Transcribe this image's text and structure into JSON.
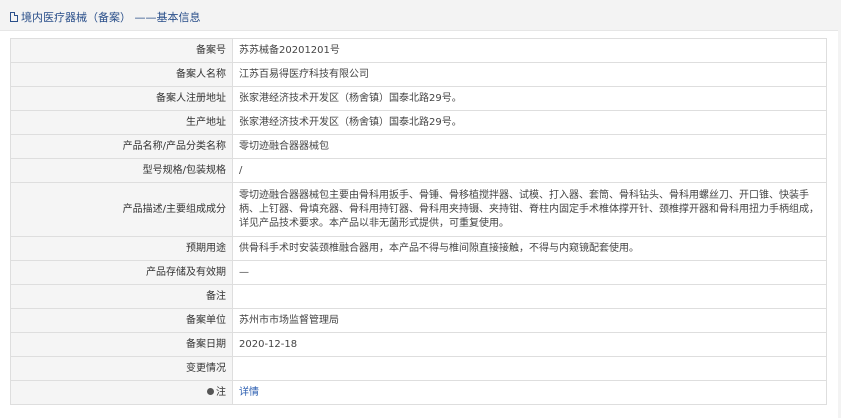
{
  "title": "境内医疗器械（备案） ——基本信息",
  "rows": [
    {
      "label": "备案号",
      "value": "苏苏械备20201201号"
    },
    {
      "label": "备案人名称",
      "value": "江苏百易得医疗科技有限公司"
    },
    {
      "label": "备案人注册地址",
      "value": "张家港经济技术开发区（杨舍镇）国泰北路29号。"
    },
    {
      "label": "生产地址",
      "value": "张家港经济技术开发区（杨舍镇）国泰北路29号。"
    },
    {
      "label": "产品名称/产品分类名称",
      "value": "零切迹融合器器械包"
    },
    {
      "label": "型号规格/包装规格",
      "value": "/"
    },
    {
      "label": "产品描述/主要组成成分",
      "value": "零切迹融合器器械包主要由骨科用扳手、骨锤、骨移植搅拌器、试模、打入器、套筒、骨科钻头、骨科用螺丝刀、开口锥、快装手柄、上钉器、骨填充器、骨科用持钉器、骨科用夹持镊、夹持钳、脊柱内固定手术椎体撑开针、颈椎撑开器和骨科用扭力手柄组成，详见产品技术要求。本产品以非无菌形式提供，可重复使用。"
    },
    {
      "label": "预期用途",
      "value": "供骨科手术时安装颈椎融合器用，本产品不得与椎间隙直接接触，不得与内窥镜配套使用。"
    },
    {
      "label": "产品存储及有效期",
      "value": "—"
    },
    {
      "label": "备注",
      "value": ""
    },
    {
      "label": "备案单位",
      "value": "苏州市市场监督管理局"
    },
    {
      "label": "备案日期",
      "value": "2020-12-18"
    },
    {
      "label": "变更情况",
      "value": ""
    },
    {
      "label": "注",
      "value": "详情"
    }
  ]
}
